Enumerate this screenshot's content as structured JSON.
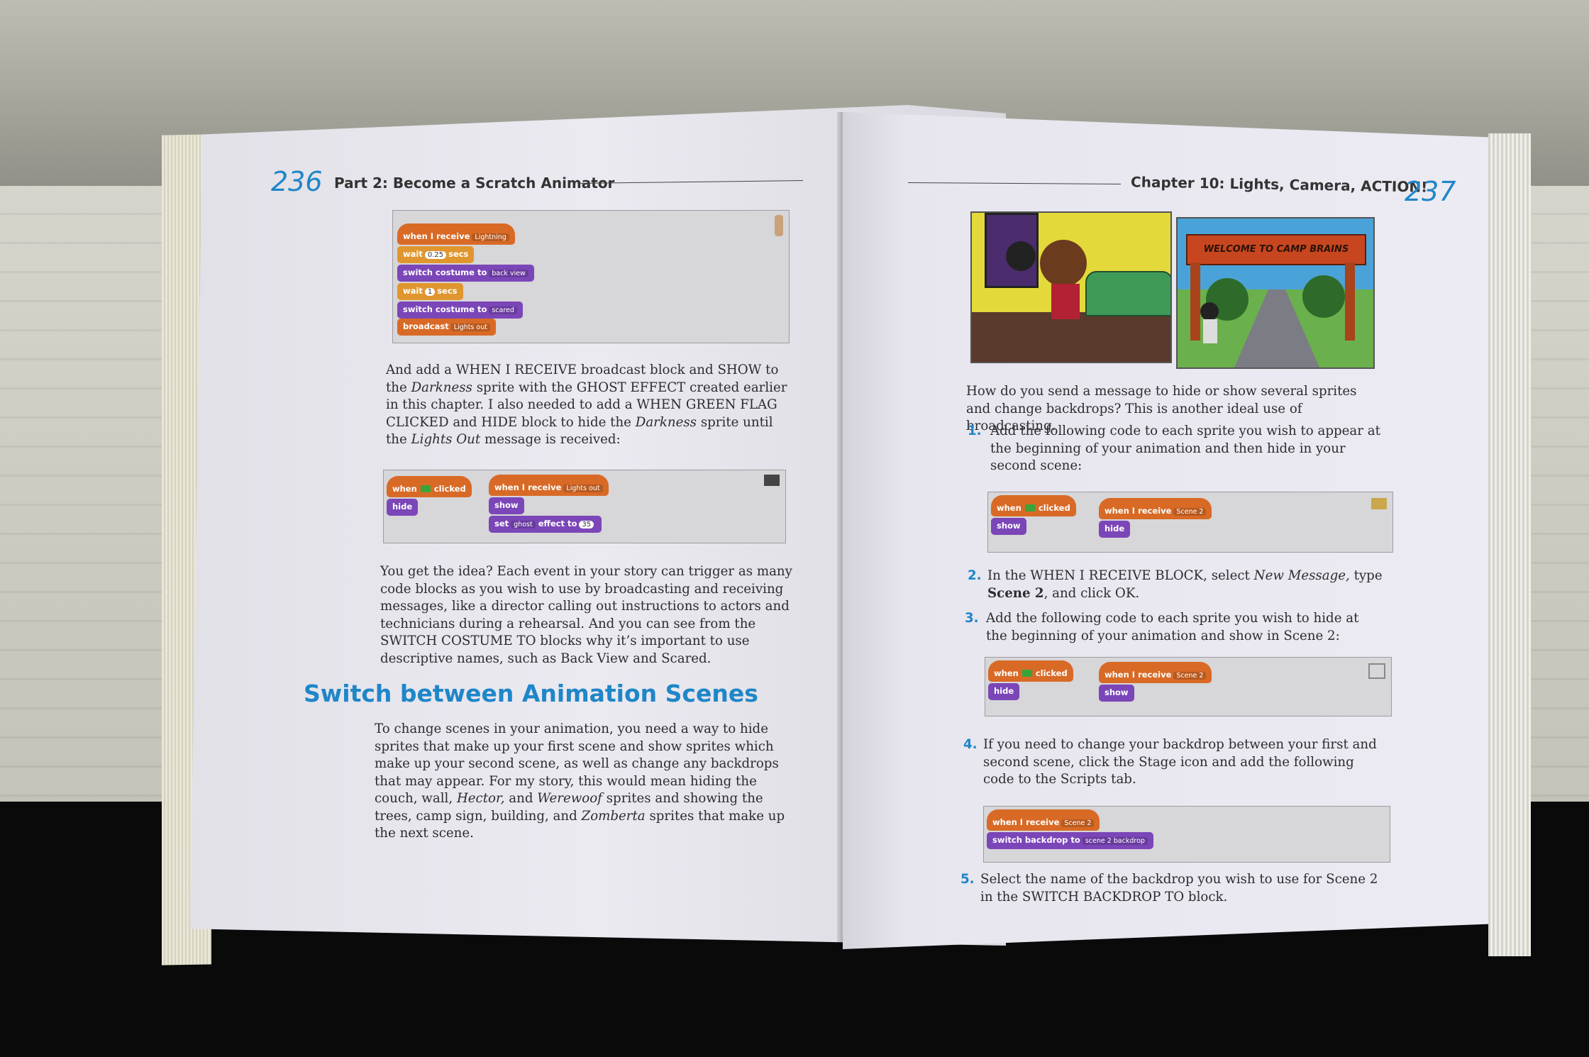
{
  "left_page": {
    "number": "236",
    "header": "Part 2: Become a Scratch Animator",
    "script1": {
      "b1": "when I receive",
      "b1_dd": "Lightning",
      "b2": "wait",
      "b2_val": "0.25",
      "b2_end": "secs",
      "b3": "switch costume to",
      "b3_dd": "back view",
      "b4": "wait",
      "b4_val": "1",
      "b4_end": "secs",
      "b5": "switch costume to",
      "b5_dd": "scared",
      "b6": "broadcast",
      "b6_dd": "Lights out"
    },
    "para1": "And add a WHEN I RECEIVE broadcast block and SHOW to the Darkness sprite with the GHOST EFFECT created earlier in this chapter. I also needed to add a WHEN GREEN FLAG CLICKED and HIDE block to hide the Darkness sprite until the Lights Out message is received:",
    "para1_parts": {
      "a": "And add a WHEN I RECEIVE broadcast block and SHOW to the",
      "b": "Darkness",
      "c": "sprite with the GHOST EFFECT created earlier in this chapter. I also needed to add a WHEN GREEN FLAG CLICKED and HIDE block to hide the",
      "d": "Darkness",
      "e": "sprite until the",
      "f": "Lights Out",
      "g": "message is received:"
    },
    "script2": {
      "flag_when": "when",
      "flag_clicked": "clicked",
      "hide": "hide",
      "recv": "when I receive",
      "recv_dd": "Lights out",
      "show": "show",
      "set": "set",
      "set_dd": "ghost",
      "effect_to": "effect to",
      "effect_val": "35"
    },
    "para2": "You get the idea? Each event in your story can trigger as many code blocks as you wish to use by broadcasting and receiving messages, like a director calling out instructions to actors and technicians during a rehearsal. And you can see from the SWITCH COSTUME TO blocks why it’s important to use descriptive names, such as Back View and Scared.",
    "section_title": "Switch between Animation Scenes",
    "para3_parts": {
      "a": "To change scenes in your animation, you need a way to hide sprites that make up your first scene and show sprites which make up your second scene, as well as change any backdrops that may appear. For my story, this would mean hiding the couch, wall,",
      "b": "Hector,",
      "c": "and",
      "d": "Werewoof",
      "e": "sprites and showing the trees, camp sign, building, and",
      "f": "Zomberta",
      "g": "sprites that make up the next scene."
    }
  },
  "right_page": {
    "number": "237",
    "header": "Chapter 10: Lights, Camera, ACTION!",
    "camp_sign": "WELCOME TO CAMP BRAINS",
    "intro": "How do you send a message to hide or show several sprites and change backdrops? This is another ideal use of broadcasting.",
    "steps": [
      {
        "num": "1.",
        "text": "Add the following code to each sprite you wish to appear at the beginning of your animation and then hide in your second scene:"
      },
      {
        "num": "2.",
        "text_a": "In the WHEN I RECEIVE BLOCK, select",
        "text_b": "New Message,",
        "text_c": "type",
        "text_d": "Scene 2",
        "text_e": ", and click OK."
      },
      {
        "num": "3.",
        "text": "Add the following code to each sprite you wish to hide at the beginning of your animation and show in Scene 2:"
      },
      {
        "num": "4.",
        "text": "If you need to change your backdrop between your first and second scene, click the Stage icon and add the following code to the Scripts tab."
      },
      {
        "num": "5.",
        "text": "Select the name of the backdrop you wish to use for Scene 2 in the SWITCH BACKDROP TO block."
      }
    ],
    "script_a": {
      "when": "when",
      "clicked": "clicked",
      "show": "show",
      "recv": "when I receive",
      "recv_dd": "Scene 2",
      "hide": "hide"
    },
    "script_b": {
      "when": "when",
      "clicked": "clicked",
      "hide": "hide",
      "recv": "when I receive",
      "recv_dd": "Scene 2",
      "show": "show"
    },
    "script_c": {
      "recv": "when I receive",
      "recv_dd": "Scene 2",
      "switch": "switch backdrop to",
      "switch_dd": "scene 2 backdrop"
    }
  },
  "colors": {
    "accent_blue": "#1f86c8",
    "events_orange": "#d86a26",
    "control_gold": "#e0962f",
    "looks_purple": "#7b46b8"
  }
}
